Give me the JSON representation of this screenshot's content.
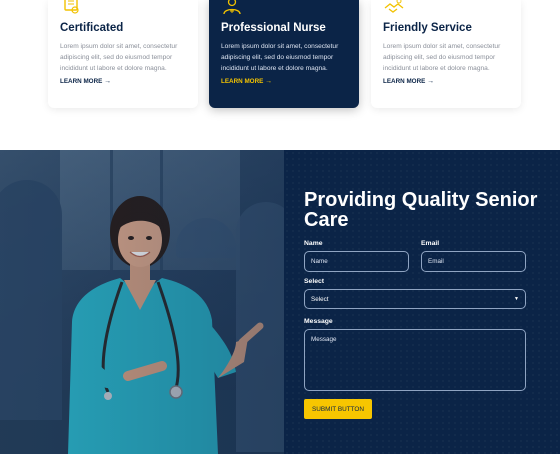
{
  "features": [
    {
      "title": "Certificated",
      "description": "Lorem ipsum dolor sit amet, consectetur adipiscing elit, sed do eiusmod tempor incididunt ut labore et dolore magna.",
      "link_label": "LEARN MORE",
      "icon": "certificate-icon"
    },
    {
      "title": "Professional Nurse",
      "description": "Lorem ipsum dolor sit amet, consectetur adipiscing elit, sed do eiusmod tempor incididunt ut labore et dolore magna.",
      "link_label": "LEARN MORE",
      "icon": "nurse-icon"
    },
    {
      "title": "Friendly Service",
      "description": "Lorem ipsum dolor sit amet, consectetur adipiscing elit, sed do eiusmod tempor incididunt ut labore et dolore magna.",
      "link_label": "LEARN MORE",
      "icon": "handshake-icon"
    }
  ],
  "arrow_glyph": "→",
  "hero": {
    "heading": "Providing Quality Senior Care",
    "form": {
      "name_label": "Name",
      "name_placeholder": "Name",
      "email_label": "Email",
      "email_placeholder": "Email",
      "select_label": "Select",
      "select_value": "Select",
      "message_label": "Message",
      "message_placeholder": "Message",
      "submit_label": "SUBMIT BUTTON"
    }
  },
  "colors": {
    "navy": "#0b2447",
    "accent_yellow": "#f7c600",
    "card_text_muted": "#8a8f99"
  }
}
